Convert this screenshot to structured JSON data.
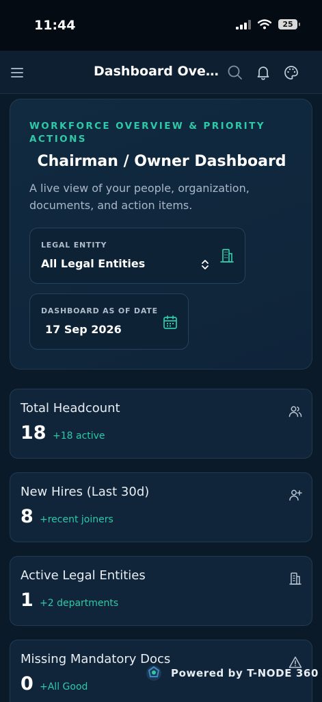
{
  "status_bar": {
    "time": "11:44",
    "battery": "25"
  },
  "app_bar": {
    "title": "Dashboard Overview"
  },
  "hero": {
    "eyebrow": "WORKFORCE OVERVIEW & PRIORITY ACTIONS",
    "title": "Chairman / Owner Dashboard",
    "description": "A live view of your people, organization, documents, and action items.",
    "legal_entity": {
      "label": "LEGAL ENTITY",
      "value": "All Legal Entities"
    },
    "as_of_date": {
      "label": "DASHBOARD AS OF DATE",
      "value": "17 Sep 2026"
    }
  },
  "stats": [
    {
      "title": "Total Headcount",
      "value": "18",
      "sub": "+18 active",
      "icon": "users-icon"
    },
    {
      "title": "New Hires (Last 30d)",
      "value": "8",
      "sub": "+recent joiners",
      "icon": "user-plus-icon"
    },
    {
      "title": "Active Legal Entities",
      "value": "1",
      "sub": "+2 departments",
      "icon": "building-icon"
    },
    {
      "title": "Missing Mandatory Docs",
      "value": "0",
      "sub": "+All Good",
      "icon": "warning-icon"
    }
  ],
  "footer": {
    "powered_by": "Powered by T-NODE 360"
  },
  "colors": {
    "accent": "#2ec9a8",
    "background": "#0b1a28",
    "card": "#102539"
  }
}
